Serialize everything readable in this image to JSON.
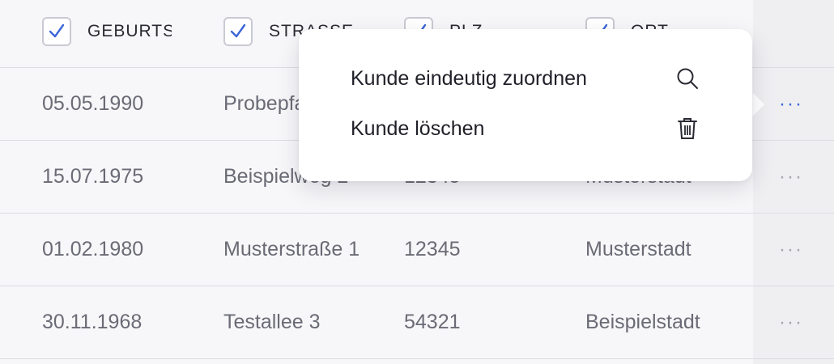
{
  "header": {
    "columns": [
      {
        "label": "GEBURTSDATUM",
        "checked": true
      },
      {
        "label": "STRASSE",
        "checked": true
      },
      {
        "label": "PLZ",
        "checked": true
      },
      {
        "label": "ORT",
        "checked": true
      }
    ]
  },
  "rows": [
    {
      "geburtsdatum": "05.05.1990",
      "strasse": "Probepfad 4",
      "plz": "",
      "ort": ""
    },
    {
      "geburtsdatum": "15.07.1975",
      "strasse": "Beispielweg 2",
      "plz": "12345",
      "ort": "Musterstadt"
    },
    {
      "geburtsdatum": "01.02.1980",
      "strasse": "Musterstraße 1",
      "plz": "12345",
      "ort": "Musterstadt"
    },
    {
      "geburtsdatum": "30.11.1968",
      "strasse": "Testallee 3",
      "plz": "54321",
      "ort": "Beispielstadt"
    }
  ],
  "row_action_label": "···",
  "context_menu": {
    "items": [
      {
        "label": "Kunde eindeutig zuordnen",
        "icon": "search-icon"
      },
      {
        "label": "Kunde löschen",
        "icon": "trash-icon"
      }
    ]
  },
  "colors": {
    "accent": "#3b66d9",
    "text": "#6b6b76",
    "header_text": "#2a2a33",
    "background": "#f7f7f9"
  }
}
